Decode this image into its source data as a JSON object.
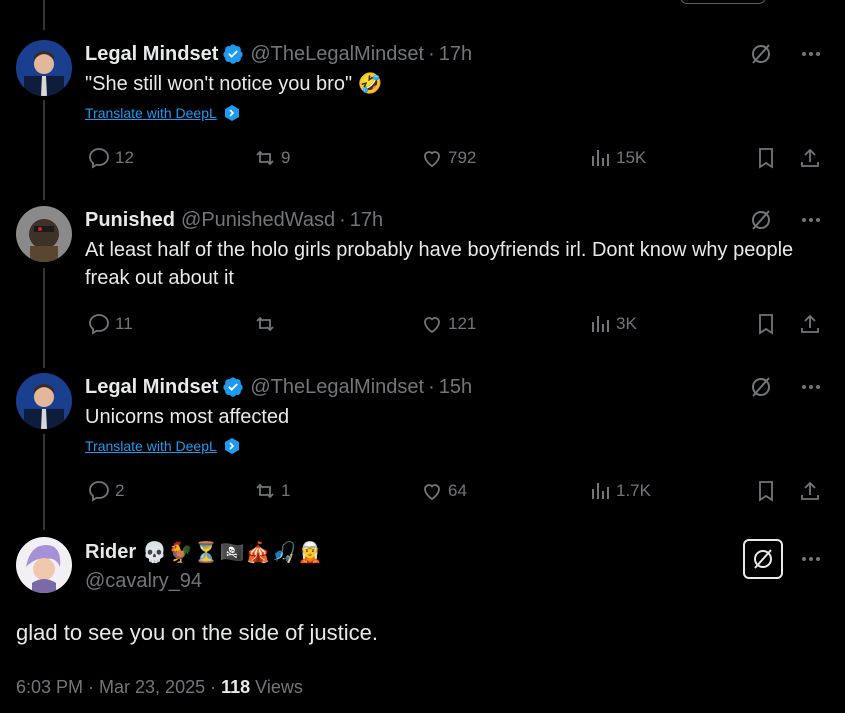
{
  "tweets": [
    {
      "name": "Legal Mindset",
      "verified": true,
      "handle": "@TheLegalMindset",
      "time": "17h",
      "text": "\"She still won't notice you bro\" 🤣",
      "translate": "Translate with DeepL",
      "replies": "12",
      "reposts": "9",
      "likes": "792",
      "views": "15K"
    },
    {
      "name": "Punished",
      "verified": false,
      "handle": "@PunishedWasd",
      "time": "17h",
      "text": "At least half of the holo girls probably have boyfriends irl. Dont know why people freak out about it",
      "replies": "11",
      "reposts": "",
      "likes": "121",
      "views": "3K"
    },
    {
      "name": "Legal Mindset",
      "verified": true,
      "handle": "@TheLegalMindset",
      "time": "15h",
      "text": "Unicorns most affected",
      "translate": "Translate with DeepL",
      "replies": "2",
      "reposts": "1",
      "likes": "64",
      "views": "1.7K"
    }
  ],
  "main": {
    "name": "Rider",
    "emoji": "💀🐓⏳🏴‍☠️🎪🎣🧝",
    "handle": "@cavalry_94",
    "text": "glad to see you on the side of justice.",
    "time": "6:03 PM · Mar 23, 2025 · ",
    "views_count": "118",
    "views_label": " Views"
  },
  "colors": {
    "bg": "#000000",
    "text": "#e7e9ea",
    "muted": "#71767b",
    "link": "#1d9bf0",
    "verified": "#1d9bf0"
  },
  "icons": [
    "grok-icon",
    "more-icon",
    "reply-icon",
    "repost-icon",
    "like-icon",
    "views-icon",
    "bookmark-icon",
    "share-icon",
    "deepl-icon",
    "verified-badge-icon"
  ]
}
